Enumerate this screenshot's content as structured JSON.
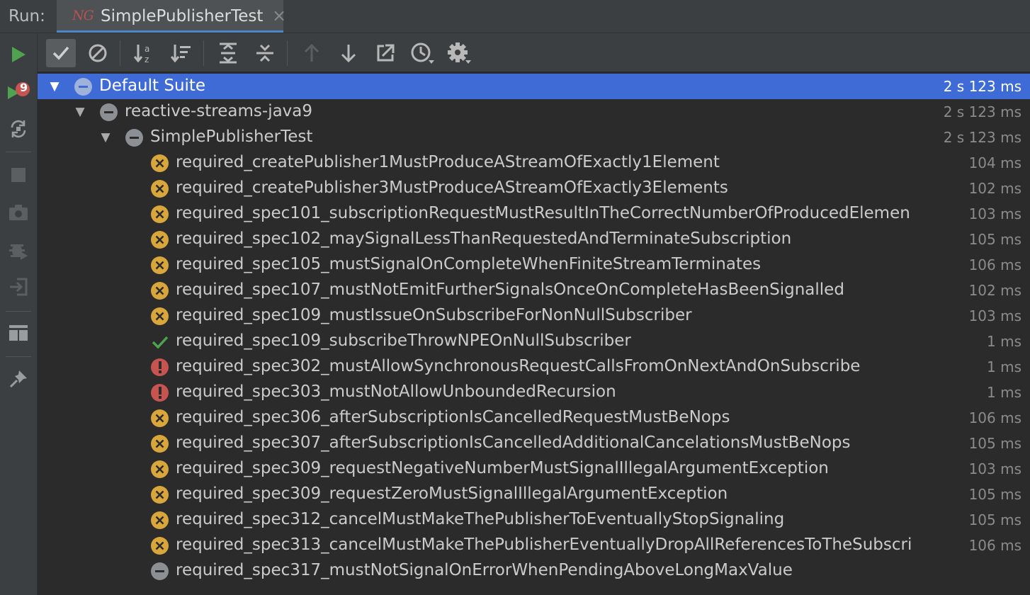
{
  "window": {
    "run_label": "Run:",
    "tab_title": "SimplePublisherTest",
    "tab_icon_text": "NG",
    "tab_close": "×"
  },
  "left_toolbar": {
    "icons": [
      "run-icon",
      "rerun-failed-icon",
      "toggle-auto-test-icon",
      "stop-icon",
      "screenshot-icon",
      "debug-icon",
      "exit-icon",
      "layout-icon",
      "pin-icon"
    ],
    "rerun_badge": "9"
  },
  "toolbar": {
    "icons": [
      "show-passed-icon",
      "show-ignored-icon",
      "sort-alphabetically-icon",
      "sort-by-duration-icon",
      "expand-all-icon",
      "collapse-all-icon",
      "previous-failed-icon",
      "next-failed-icon",
      "export-icon",
      "history-icon",
      "settings-icon"
    ]
  },
  "colors": {
    "selection": "#3e6bd6",
    "failed": "#d8a63a",
    "error": "#c75450",
    "passed": "#4fa34f",
    "ignored": "#8c8f93"
  },
  "tree": [
    {
      "name": "Default Suite",
      "time": "2 s 123 ms",
      "status": "ignored",
      "level": 0,
      "expanded": true,
      "selected": true
    },
    {
      "name": "reactive-streams-java9",
      "time": "2 s 123 ms",
      "status": "ignored",
      "level": 1,
      "expanded": true
    },
    {
      "name": "SimplePublisherTest",
      "time": "2 s 123 ms",
      "status": "ignored",
      "level": 2,
      "expanded": true
    },
    {
      "name": "required_createPublisher1MustProduceAStreamOfExactly1Element",
      "time": "104 ms",
      "status": "failed",
      "level": 3
    },
    {
      "name": "required_createPublisher3MustProduceAStreamOfExactly3Elements",
      "time": "102 ms",
      "status": "failed",
      "level": 3
    },
    {
      "name": "required_spec101_subscriptionRequestMustResultInTheCorrectNumberOfProducedElemen",
      "time": "103 ms",
      "status": "failed",
      "level": 3
    },
    {
      "name": "required_spec102_maySignalLessThanRequestedAndTerminateSubscription",
      "time": "105 ms",
      "status": "failed",
      "level": 3
    },
    {
      "name": "required_spec105_mustSignalOnCompleteWhenFiniteStreamTerminates",
      "time": "106 ms",
      "status": "failed",
      "level": 3
    },
    {
      "name": "required_spec107_mustNotEmitFurtherSignalsOnceOnCompleteHasBeenSignalled",
      "time": "102 ms",
      "status": "failed",
      "level": 3
    },
    {
      "name": "required_spec109_mustIssueOnSubscribeForNonNullSubscriber",
      "time": "103 ms",
      "status": "failed",
      "level": 3
    },
    {
      "name": "required_spec109_subscribeThrowNPEOnNullSubscriber",
      "time": "1 ms",
      "status": "passed",
      "level": 3
    },
    {
      "name": "required_spec302_mustAllowSynchronousRequestCallsFromOnNextAndOnSubscribe",
      "time": "1 ms",
      "status": "error",
      "level": 3
    },
    {
      "name": "required_spec303_mustNotAllowUnboundedRecursion",
      "time": "1 ms",
      "status": "error",
      "level": 3
    },
    {
      "name": "required_spec306_afterSubscriptionIsCancelledRequestMustBeNops",
      "time": "106 ms",
      "status": "failed",
      "level": 3
    },
    {
      "name": "required_spec307_afterSubscriptionIsCancelledAdditionalCancelationsMustBeNops",
      "time": "105 ms",
      "status": "failed",
      "level": 3
    },
    {
      "name": "required_spec309_requestNegativeNumberMustSignalIllegalArgumentException",
      "time": "103 ms",
      "status": "failed",
      "level": 3
    },
    {
      "name": "required_spec309_requestZeroMustSignalIllegalArgumentException",
      "time": "105 ms",
      "status": "failed",
      "level": 3
    },
    {
      "name": "required_spec312_cancelMustMakeThePublisherToEventuallyStopSignaling",
      "time": "105 ms",
      "status": "failed",
      "level": 3
    },
    {
      "name": "required_spec313_cancelMustMakeThePublisherEventuallyDropAllReferencesToTheSubscri",
      "time": "106 ms",
      "status": "failed",
      "level": 3
    },
    {
      "name": "required_spec317_mustNotSignalOnErrorWhenPendingAboveLongMaxValue",
      "time": "",
      "status": "ignored",
      "level": 3
    }
  ]
}
